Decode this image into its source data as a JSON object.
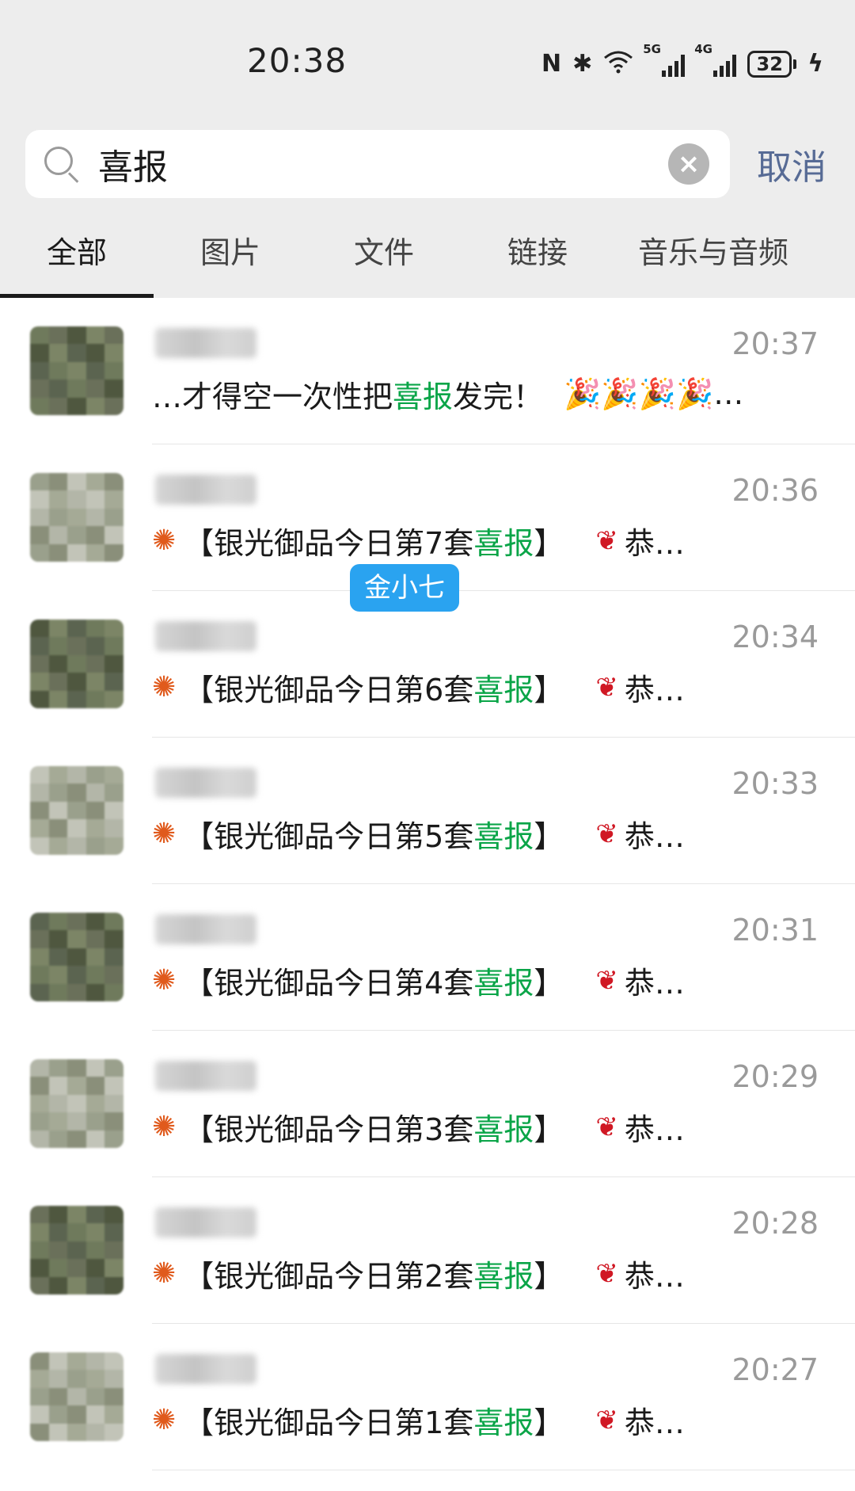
{
  "status": {
    "time": "20:38",
    "battery": "32"
  },
  "search": {
    "query": "喜报",
    "cancel": "取消"
  },
  "tabs": [
    {
      "label": "全部",
      "active": true
    },
    {
      "label": "图片"
    },
    {
      "label": "文件"
    },
    {
      "label": "链接"
    },
    {
      "label": "音乐与音频"
    }
  ],
  "results": [
    {
      "time": "20:37",
      "prefix": "…才得空一次性把",
      "keyword": "喜报",
      "suffix": "发完！",
      "tail": "🎉🎉🎉🎉…"
    },
    {
      "time": "20:36",
      "prefix": "【银光御品今日第7套",
      "keyword": "喜报",
      "suffix": "】",
      "tail": "恭…"
    },
    {
      "time": "20:34",
      "prefix": "【银光御品今日第6套",
      "keyword": "喜报",
      "suffix": "】",
      "tail": "恭…"
    },
    {
      "time": "20:33",
      "prefix": "【银光御品今日第5套",
      "keyword": "喜报",
      "suffix": "】",
      "tail": "恭…"
    },
    {
      "time": "20:31",
      "prefix": "【银光御品今日第4套",
      "keyword": "喜报",
      "suffix": "】",
      "tail": "恭…"
    },
    {
      "time": "20:29",
      "prefix": "【银光御品今日第3套",
      "keyword": "喜报",
      "suffix": "】",
      "tail": "恭…"
    },
    {
      "time": "20:28",
      "prefix": "【银光御品今日第2套",
      "keyword": "喜报",
      "suffix": "】",
      "tail": "恭…"
    },
    {
      "time": "20:27",
      "prefix": "【银光御品今日第1套",
      "keyword": "喜报",
      "suffix": "】",
      "tail": "恭…"
    }
  ],
  "tooltip": "金小七",
  "colors": {
    "highlight": "#0aa548",
    "cancel": "#576b95",
    "tooltip_bg": "#2aa3f0"
  }
}
